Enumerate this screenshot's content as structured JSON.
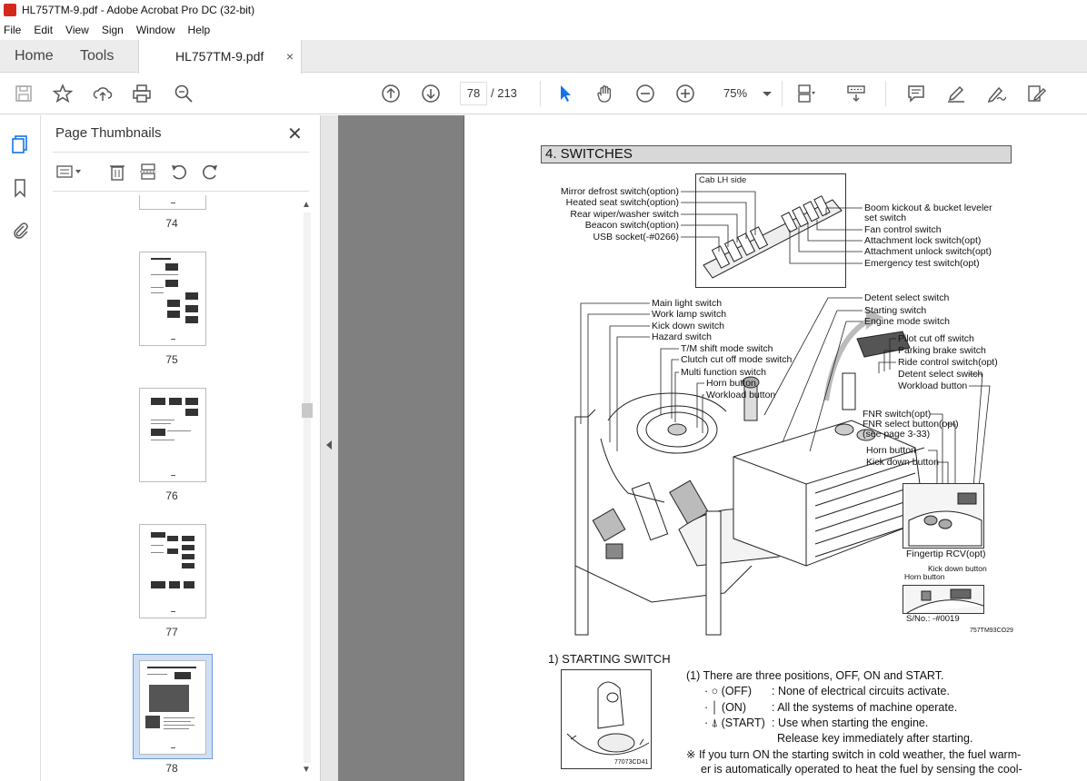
{
  "window": {
    "title": "HL757TM-9.pdf - Adobe Acrobat Pro DC (32-bit)"
  },
  "menu": [
    "File",
    "Edit",
    "View",
    "Sign",
    "Window",
    "Help"
  ],
  "tabs": {
    "home": "Home",
    "tools": "Tools",
    "document": "HL757TM-9.pdf",
    "close": "×"
  },
  "toolbar": {
    "page_current": "78",
    "page_total": "/ 213",
    "zoom": "75%"
  },
  "thumbnails": {
    "title": "Page Thumbnails",
    "close": "✕",
    "pages": [
      "74",
      "75",
      "76",
      "77",
      "78"
    ],
    "selected": "78"
  },
  "document": {
    "section_title": "4. SWITCHES",
    "cab_caption": "Cab LH side",
    "cab_left_labels": [
      "Mirror defrost switch(option)",
      "Heated seat switch(option)",
      "Rear wiper/washer switch",
      "Beacon switch(option)",
      "USB socket(-#0266)"
    ],
    "cab_right_labels": [
      "Boom kickout & bucket leveler",
      "set switch",
      "Fan control switch",
      "Attachment lock switch(opt)",
      "Attachment unlock switch(opt)",
      "Emergency test switch(opt)"
    ],
    "mid_left_labels": [
      "Main light switch",
      "Work lamp switch",
      "Kick down switch",
      "Hazard switch",
      "T/M shift mode switch",
      "Clutch cut off mode switch",
      "Multi function switch",
      "Horn button",
      "Workload button"
    ],
    "mid_right_labels": [
      "Detent select switch",
      "Starting switch",
      "Engine mode switch",
      "Pilot cut off switch",
      "Parking brake switch",
      "Ride control switch(opt)",
      "Detent select switch",
      "Workload button"
    ],
    "fnr_labels": [
      "FNR switch(opt)",
      "FNR select button(opt)",
      "(see page 3-33)",
      "Horn button",
      "Kick down button"
    ],
    "fingertip_caption": "Fingertip RCV(opt)",
    "small_kick": "Kick down button",
    "small_horn": "Horn button",
    "sn": "S/No.: -#0019",
    "fig_code": "757TM93CO29",
    "sub_heading": "1) STARTING SWITCH",
    "start_fig_code": "77073CD41",
    "para1": "(1) There are three positions, OFF, ON and START.",
    "off_key": "· ○ (OFF)",
    "off_desc": ": None of electrical circuits activate.",
    "on_key": "· │ (ON)",
    "on_desc": ": All the systems of machine operate.",
    "start_key": "· ⍋ (START)",
    "start_desc": ": Use when starting the engine.",
    "start_desc2": "Release key immediately after starting.",
    "note1": "※  If you turn ON the starting switch in cold weather, the fuel warm-",
    "note2": "er is automatically operated to heat the fuel by sensing the cool-"
  }
}
